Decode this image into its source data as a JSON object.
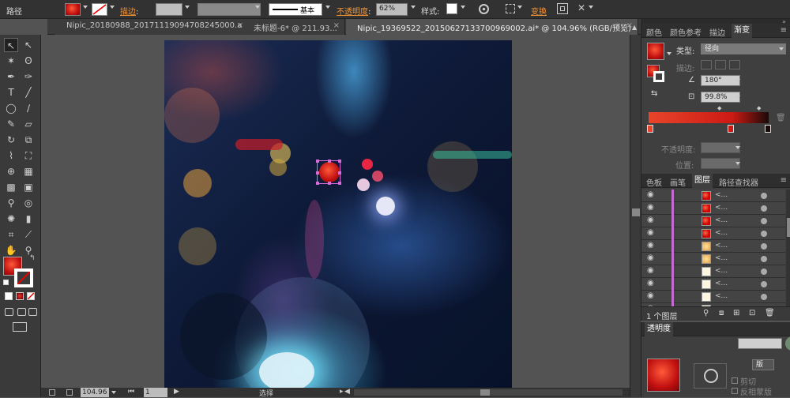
{
  "control_bar": {
    "title": "路径",
    "stroke_label": "描边",
    "stroke_style": "基本",
    "opacity_label": "不透明度",
    "opacity_value": "62%",
    "style_label": "样式",
    "transform_label": "变换"
  },
  "tabs": [
    {
      "label": "Nipic_20180988_20171119094708245000.ai*",
      "active": false
    },
    {
      "label": "未标题-6* @ 211.93...",
      "active": false
    },
    {
      "label": "Nipic_19369522_20150627133700969002.ai* @ 104.96% (RGB/预览)",
      "active": true
    }
  ],
  "status_bar": {
    "zoom": "104.96",
    "artboard": "1",
    "tool": "选择"
  },
  "panels": {
    "gradient_tabs": [
      "颜色",
      "颜色参考",
      "描边",
      "渐变"
    ],
    "type_label": "类型",
    "type_value": "径向",
    "stroke_label": "描边",
    "angle_value": "180°",
    "ratio_value": "99.8%",
    "opacity_label": "不透明度",
    "position_label": "位置",
    "layers_tabs": [
      "色板",
      "画笔",
      "图层",
      "路径查找器"
    ],
    "layer_name": "<...",
    "layer_count": "1 个图层",
    "transparency_title": "透明度",
    "clip_label": "剪切",
    "invert_mask_label": "反相蒙版",
    "make_mask_label": "版"
  },
  "colors": {
    "fill": "#cc1a14",
    "accent": "#f29334",
    "selection": "#d96bd9",
    "gradient_start": "#e8452a",
    "gradient_end": "#1a0a08"
  },
  "layers": [
    {
      "swatch": "red",
      "name": "<..."
    },
    {
      "swatch": "red",
      "name": "<..."
    },
    {
      "swatch": "red",
      "name": "<..."
    },
    {
      "swatch": "red",
      "name": "<..."
    },
    {
      "swatch": "gold",
      "name": "<..."
    },
    {
      "swatch": "gold",
      "name": "<..."
    },
    {
      "swatch": "cream",
      "name": "<..."
    },
    {
      "swatch": "cream",
      "name": "<..."
    },
    {
      "swatch": "cream",
      "name": "<..."
    },
    {
      "swatch": "cream",
      "name": "<..."
    }
  ]
}
